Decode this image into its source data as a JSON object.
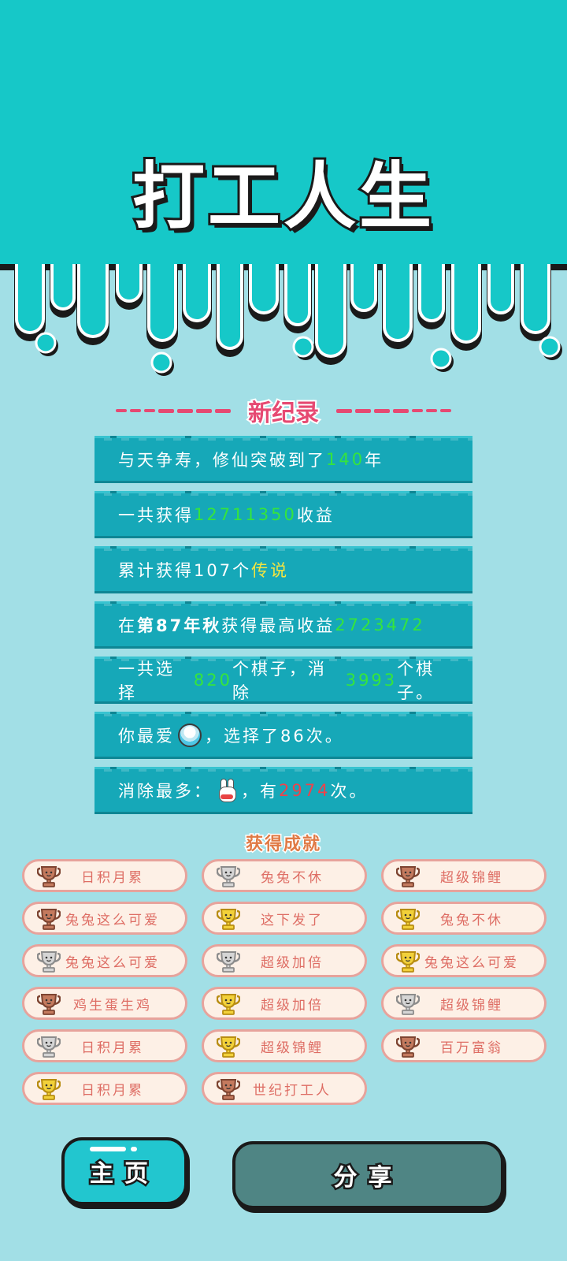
{
  "title": "打工人生",
  "new_record": {
    "header": "新纪录"
  },
  "records": [
    {
      "segments": [
        {
          "text": "与天争寿，修仙突破到了",
          "color": "white"
        },
        {
          "text": "140",
          "color": "green"
        },
        {
          "text": "年",
          "color": "white"
        }
      ]
    },
    {
      "segments": [
        {
          "text": "一共获得",
          "color": "white"
        },
        {
          "text": "12711350",
          "color": "green"
        },
        {
          "text": "收益",
          "color": "white"
        }
      ]
    },
    {
      "segments": [
        {
          "text": "累计获得107个",
          "color": "white"
        },
        {
          "text": "传说",
          "color": "yellow"
        }
      ]
    },
    {
      "segments": [
        {
          "text": "在",
          "color": "white"
        },
        {
          "text": "第87年秋",
          "color": "white",
          "bold": true
        },
        {
          "text": "获得最高收益",
          "color": "white"
        },
        {
          "text": "2723472",
          "color": "green"
        }
      ]
    },
    {
      "segments": [
        {
          "text": "一共选择",
          "color": "white"
        },
        {
          "text": "820",
          "color": "green"
        },
        {
          "text": "个棋子，消除",
          "color": "white"
        },
        {
          "text": "3993",
          "color": "green"
        },
        {
          "text": "个棋子。",
          "color": "white"
        }
      ]
    },
    {
      "segments": [
        {
          "text": "你最爱",
          "color": "white"
        },
        {
          "icon": "rice-bowl-icon"
        },
        {
          "text": "，选择了86次。",
          "color": "white"
        }
      ]
    },
    {
      "segments": [
        {
          "text": "消除最多：",
          "color": "white"
        },
        {
          "icon": "rabbit-icon"
        },
        {
          "text": "，有",
          "color": "white"
        },
        {
          "text": "2974",
          "color": "red"
        },
        {
          "text": "次。",
          "color": "white"
        }
      ]
    }
  ],
  "achievements_title": "获得成就",
  "achievements": [
    {
      "label": "日积月累",
      "trophy": "bronze"
    },
    {
      "label": "兔兔不休",
      "trophy": "silver"
    },
    {
      "label": "超级锦鲤",
      "trophy": "bronze"
    },
    {
      "label": "兔兔这么可爱",
      "trophy": "bronze"
    },
    {
      "label": "这下发了",
      "trophy": "gold"
    },
    {
      "label": "兔兔不休",
      "trophy": "gold"
    },
    {
      "label": "兔兔这么可爱",
      "trophy": "silver"
    },
    {
      "label": "超级加倍",
      "trophy": "silver"
    },
    {
      "label": "兔兔这么可爱",
      "trophy": "gold"
    },
    {
      "label": "鸡生蛋生鸡",
      "trophy": "bronze"
    },
    {
      "label": "超级加倍",
      "trophy": "gold"
    },
    {
      "label": "超级锦鲤",
      "trophy": "silver"
    },
    {
      "label": "日积月累",
      "trophy": "silver"
    },
    {
      "label": "超级锦鲤",
      "trophy": "gold"
    },
    {
      "label": "百万富翁",
      "trophy": "bronze"
    },
    {
      "label": "日积月累",
      "trophy": "gold"
    },
    {
      "label": "世纪打工人",
      "trophy": "bronze"
    }
  ],
  "buttons": {
    "home_label": "主页",
    "share_label": "分享"
  },
  "colors": {
    "header_bg": "#16c8c8",
    "page_bg": "#a2dfe6",
    "record_row": "#16a8b8",
    "accent_pink": "#e64972",
    "green": "#35e53c",
    "yellow": "#f4e540",
    "red": "#f0424a",
    "gold": "#f2d13a",
    "silver": "#c9c9c9",
    "bronze": "#c47a5e"
  }
}
